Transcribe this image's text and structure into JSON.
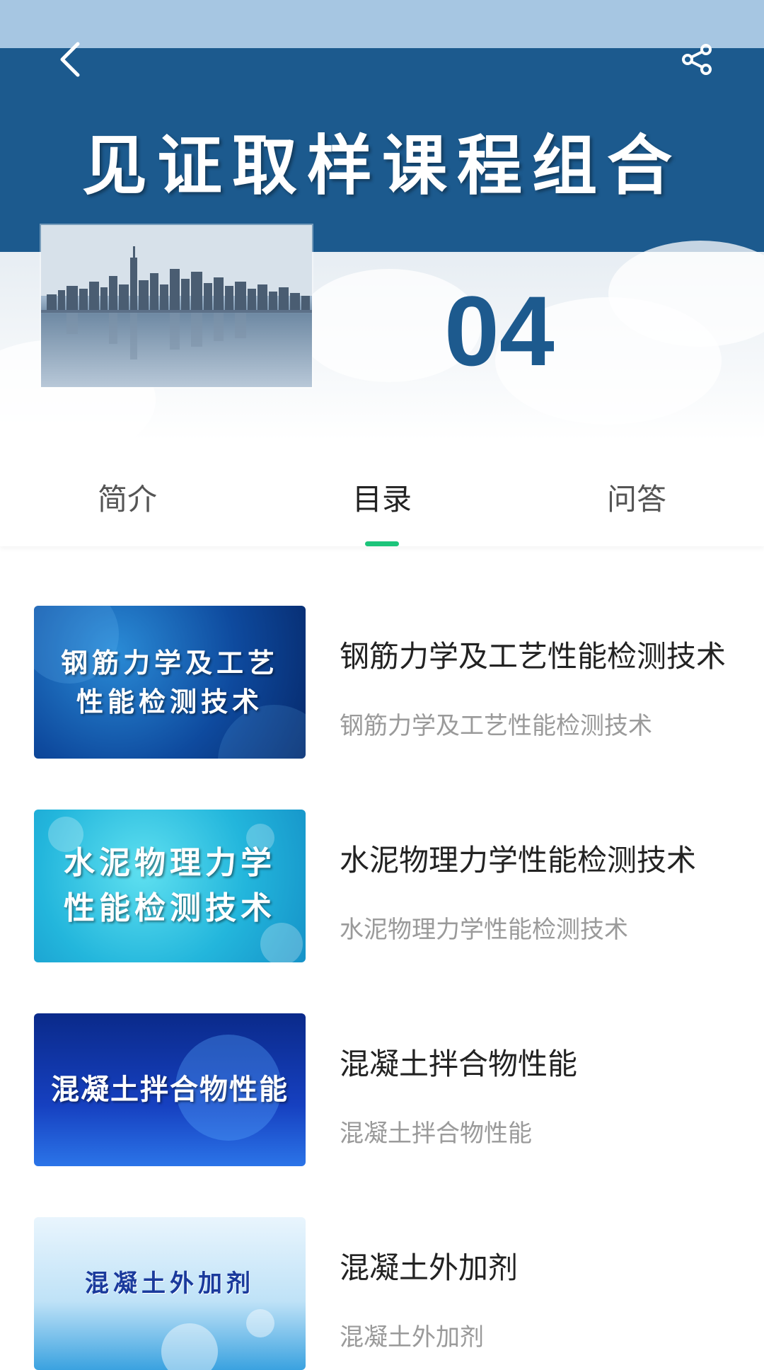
{
  "banner": {
    "title": "见证取样课程组合",
    "number": "04"
  },
  "tabs": [
    {
      "label": "简介",
      "active": false
    },
    {
      "label": "目录",
      "active": true
    },
    {
      "label": "问答",
      "active": false
    }
  ],
  "accent_color": "#1cc47a",
  "banner_color": "#1c5a8e",
  "items": [
    {
      "thumb_line1": "钢筋力学及工艺",
      "thumb_line2": "性能检测技术",
      "title": "钢筋力学及工艺性能检测技术",
      "subtitle": "钢筋力学及工艺性能检测技术"
    },
    {
      "thumb_line1": "水泥物理力学",
      "thumb_line2": "性能检测技术",
      "title": "水泥物理力学性能检测技术",
      "subtitle": "水泥物理力学性能检测技术"
    },
    {
      "thumb_line1": "混凝土拌合物性能",
      "thumb_line2": "",
      "title": "混凝土拌合物性能",
      "subtitle": "混凝土拌合物性能"
    },
    {
      "thumb_line1": "混凝土外加剂",
      "thumb_line2": "",
      "title": "混凝土外加剂",
      "subtitle": "混凝土外加剂"
    }
  ],
  "icons": {
    "back": "back-arrow-icon",
    "share": "share-icon"
  }
}
